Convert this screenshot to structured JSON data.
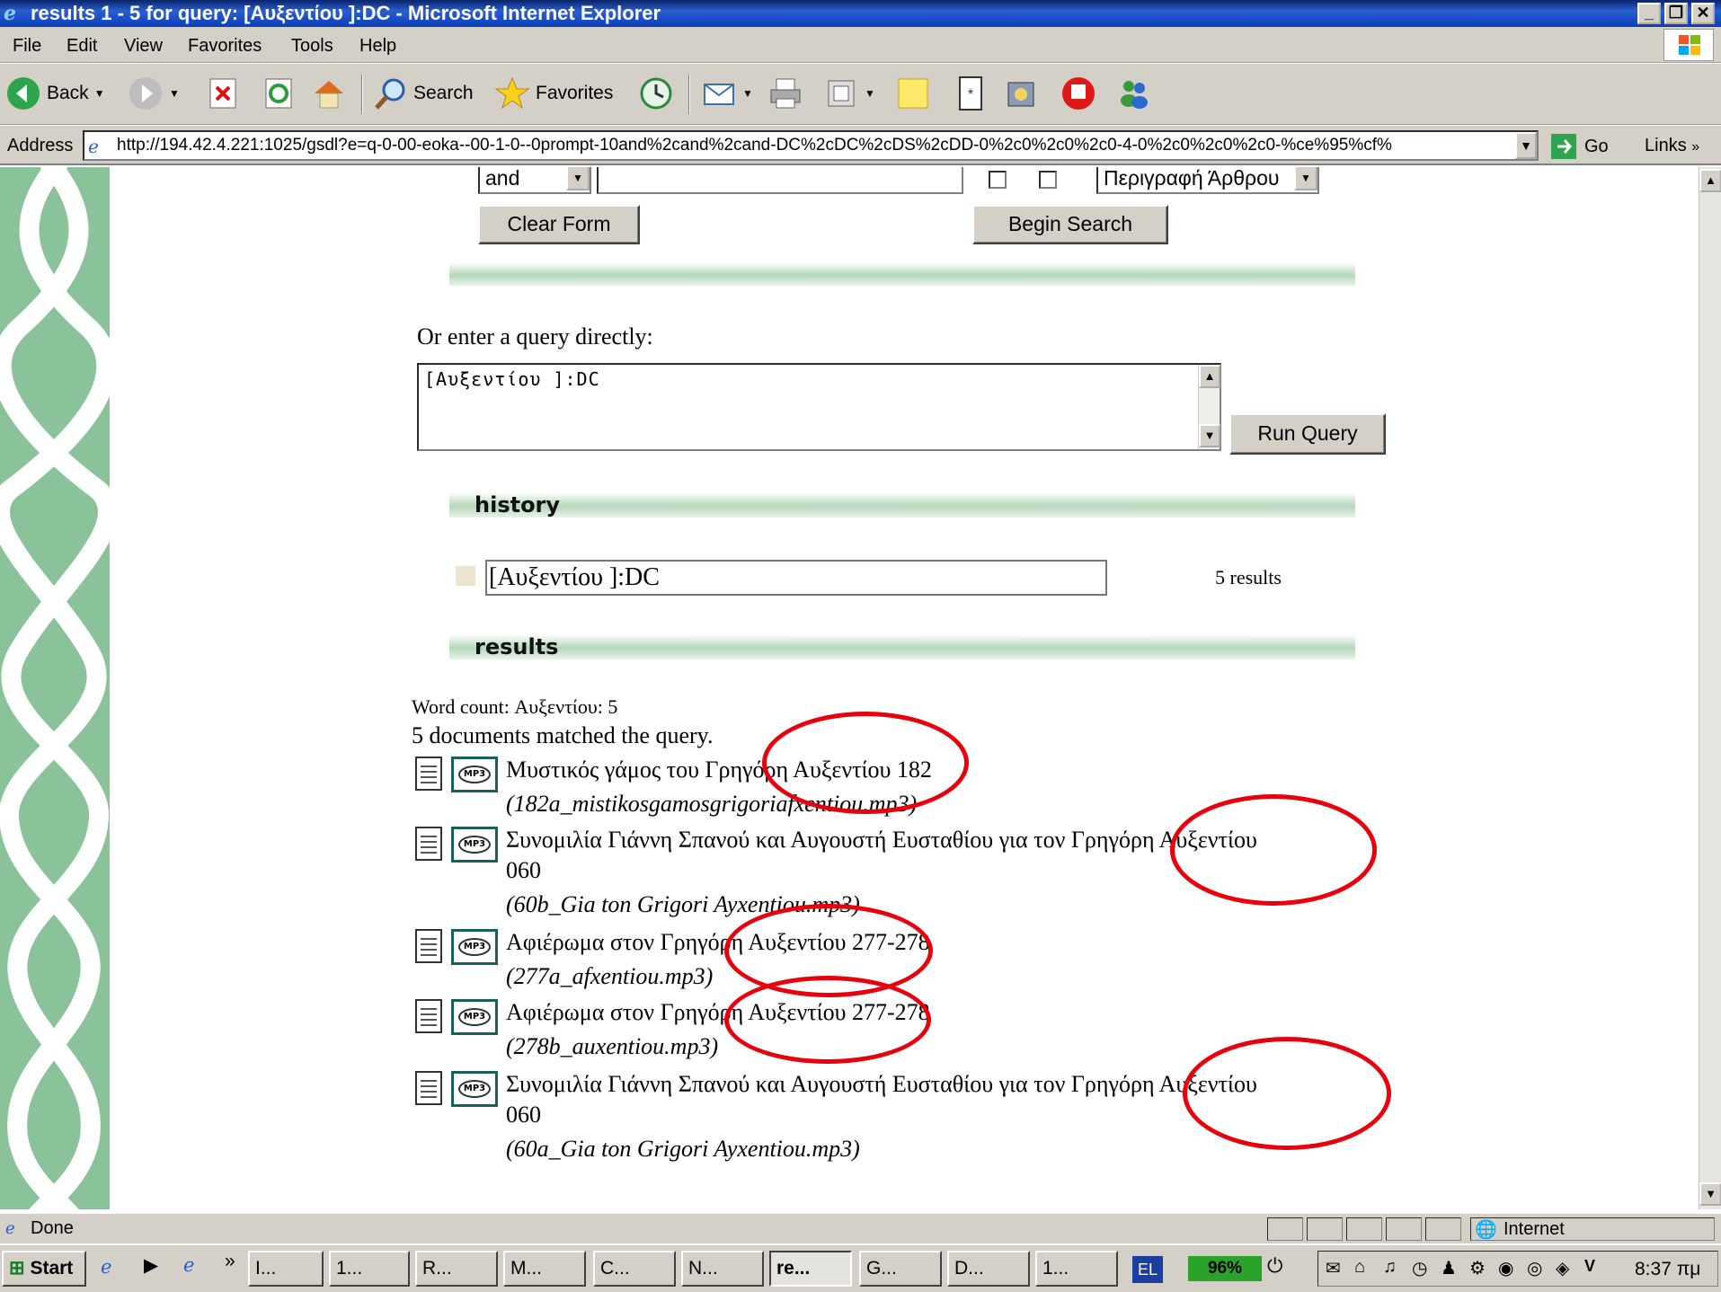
{
  "window": {
    "title": "results 1 - 5 for query: [Αυξεντίου ]:DC - Microsoft Internet Explorer",
    "controls": {
      "minimize": "_",
      "restore": "❐",
      "close": "✕"
    }
  },
  "menu": [
    "File",
    "Edit",
    "View",
    "Favorites",
    "Tools",
    "Help"
  ],
  "toolbar": {
    "back": "Back",
    "search": "Search",
    "favorites": "Favorites"
  },
  "address": {
    "label": "Address",
    "url": "http://194.42.4.221:1025/gsdl?e=q-0-00-eoka--00-1-0--0prompt-10and%2cand%2cand-DC%2cDC%2cDS%2cDD-0%2c0%2c0%2c0-4-0%2c0%2c0%2c0-%ce%95%cf%",
    "go": "Go",
    "links": "Links"
  },
  "form": {
    "operator": "and",
    "field_select": "Περιγραφή Άρθρου",
    "clear_label": "Clear Form",
    "begin_label": "Begin Search",
    "direct_prompt": "Or enter a query directly:",
    "query_text": "[Αυξεντίου ]:DC",
    "run_label": "Run Query"
  },
  "history": {
    "heading": "history",
    "query": "[Αυξεντίου ]:DC",
    "count": "5 results"
  },
  "results": {
    "heading": "results",
    "word_count": "Word count: Αυξεντίου: 5",
    "matched": "5 documents matched the query.",
    "items": [
      {
        "title": "Μυστικός γάμος του Γρηγόρη Αυξεντίου 182",
        "title2": "",
        "file": "(182a_mistikosgamosgrigoriafxentiou.mp3)"
      },
      {
        "title": "Συνομιλία Γιάννη Σπανού και Αυγουστή Ευσταθίου για τον Γρηγόρη Αυξεντίου",
        "title2": "060",
        "file": "(60b_Gia ton Grigori Ayxentiou.mp3)"
      },
      {
        "title": "Αφιέρωμα στον Γρηγόρη Αυξεντίου 277-278",
        "title2": "",
        "file": "(277a_afxentiou.mp3)"
      },
      {
        "title": "Αφιέρωμα στον Γρηγόρη Αυξεντίου 277-278",
        "title2": "",
        "file": "(278b_auxentiou.mp3)"
      },
      {
        "title": "Συνομιλία Γιάννη Σπανού και Αυγουστή Ευσταθίου για τον Γρηγόρη Αυξεντίου",
        "title2": "060",
        "file": "(60a_Gia ton Grigori Ayxentiou.mp3)"
      }
    ],
    "mp3_icon_label": "MP3"
  },
  "annotation_color": "#e8000c",
  "status": {
    "text": "Done",
    "zone": "Internet"
  },
  "taskbar": {
    "start": "Start",
    "tasks": [
      "I...",
      "1...",
      "R...",
      "M...",
      "C...",
      "N...",
      "re...",
      "G...",
      "D...",
      "1..."
    ],
    "language": "EL",
    "battery": "96%",
    "clock": "8:37 πμ"
  }
}
